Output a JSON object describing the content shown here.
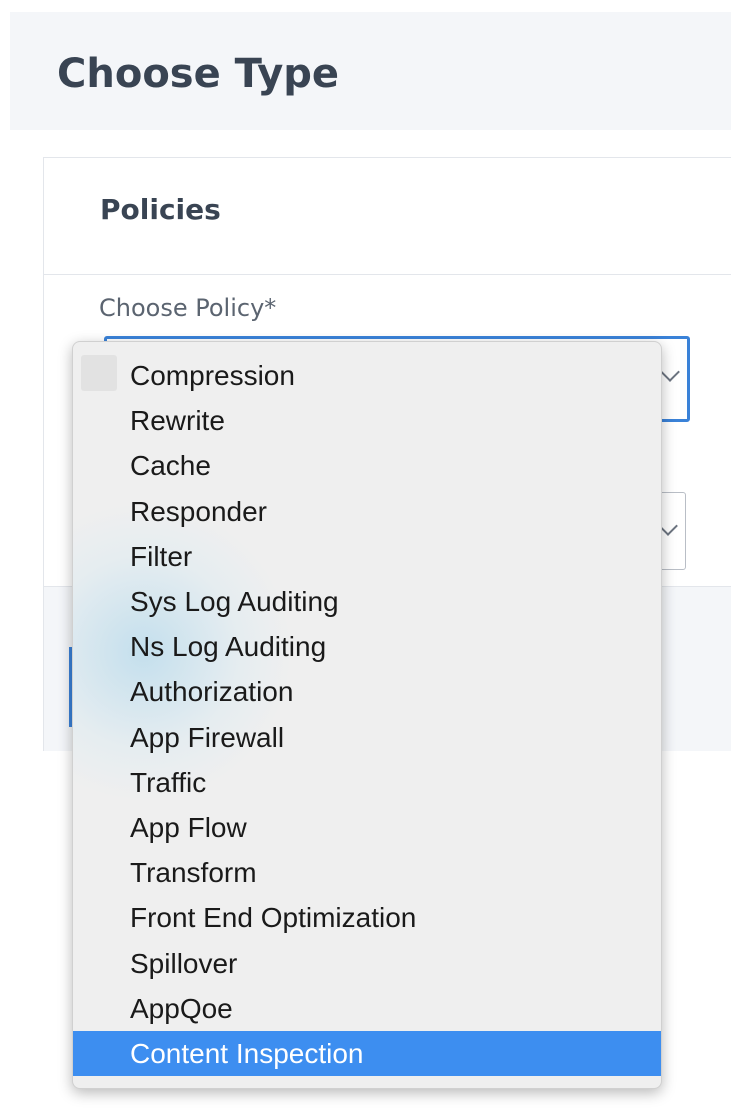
{
  "header": {
    "title": "Choose Type"
  },
  "panel": {
    "title": "Policies",
    "field_label": "Choose Policy*"
  },
  "dropdown": {
    "selected_index": 15,
    "options": [
      "Compression",
      "Rewrite",
      "Cache",
      "Responder",
      "Filter",
      "Sys Log Auditing",
      "Ns Log Auditing",
      "Authorization",
      "App Firewall",
      "Traffic",
      "App Flow",
      "Transform",
      "Front End Optimization",
      "Spillover",
      "AppQoe",
      "Content Inspection"
    ]
  },
  "colors": {
    "selection": "#3d8ef0",
    "focus_border": "#3a82d8",
    "heading_text": "#394453"
  },
  "icons": {
    "select_chevron": "chevron-down-icon"
  }
}
